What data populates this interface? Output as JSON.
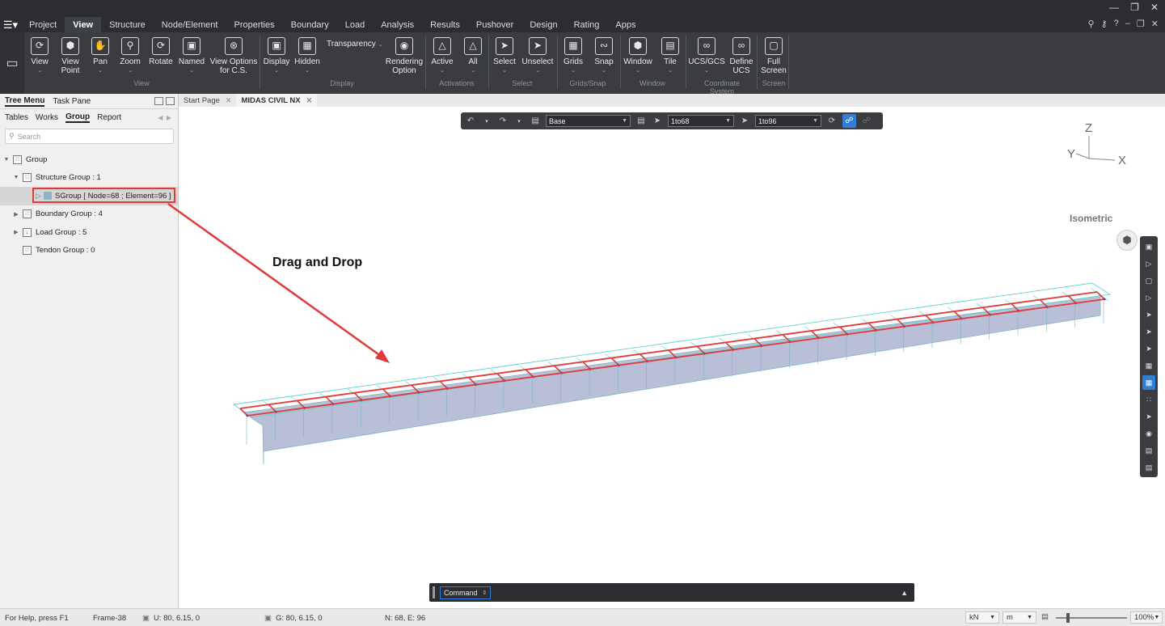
{
  "menu": {
    "tabs": [
      "Project",
      "View",
      "Structure",
      "Node/Element",
      "Properties",
      "Boundary",
      "Load",
      "Analysis",
      "Results",
      "Pushover",
      "Design",
      "Rating",
      "Apps"
    ],
    "active_tab": "View"
  },
  "ribbon": {
    "view": {
      "view": "View",
      "view_point": "View Point",
      "pan": "Pan",
      "zoom": "Zoom",
      "rotate": "Rotate",
      "named": "Named",
      "view_options": "View Options for C.S.",
      "group": "View"
    },
    "display": {
      "display": "Display",
      "hidden": "Hidden",
      "transparency": "Transparency",
      "rendering": "Rendering Option",
      "group": "Display"
    },
    "activations": {
      "active": "Active",
      "all": "All",
      "group": "Activations"
    },
    "select": {
      "select": "Select",
      "unselect": "Unselect",
      "group": "Select"
    },
    "grids": {
      "grids": "Grids",
      "snap": "Snap",
      "group": "Grids/Snap"
    },
    "window": {
      "window": "Window",
      "tile": "Tile",
      "group": "Window"
    },
    "coord": {
      "ucs": "UCS/GCS",
      "define": "Define UCS",
      "group": "Coordinate System"
    },
    "screen": {
      "full": "Full Screen",
      "group": "Screen"
    }
  },
  "left_panel": {
    "tabs": [
      "Tree Menu",
      "Task Pane"
    ],
    "subtabs": [
      "Tables",
      "Works",
      "Group",
      "Report"
    ],
    "search_placeholder": "Search",
    "tree": {
      "root": "Group",
      "structure": "Structure Group : 1",
      "sgroup": "SGroup [ Node=68 ; Element=96 ]",
      "boundary": "Boundary Group : 4",
      "load": "Load Group : 5",
      "tendon": "Tendon Group : 0"
    }
  },
  "doc_tabs": [
    "Start Page",
    "MIDAS CIVIL NX"
  ],
  "view_toolbar": {
    "base": "Base",
    "nodes": "1to68",
    "elements": "1to96"
  },
  "axes": {
    "z": "Z",
    "y": "Y",
    "x": "X"
  },
  "view_label": "Isometric",
  "annotation": "Drag and Drop",
  "command": {
    "label": "Command"
  },
  "status": {
    "help": "For Help, press F1",
    "frame": "Frame-38",
    "u": "U: 80, 6.15, 0",
    "g": "G: 80, 6.15, 0",
    "ne": "N: 68, E: 96",
    "force_unit": "kN",
    "length_unit": "m",
    "zoom": "100%"
  },
  "colors": {
    "accent": "#2f7fd8",
    "highlight": "#e03b3b",
    "model_fill": "#b9bfd6",
    "mesh": "#66d1d0"
  }
}
